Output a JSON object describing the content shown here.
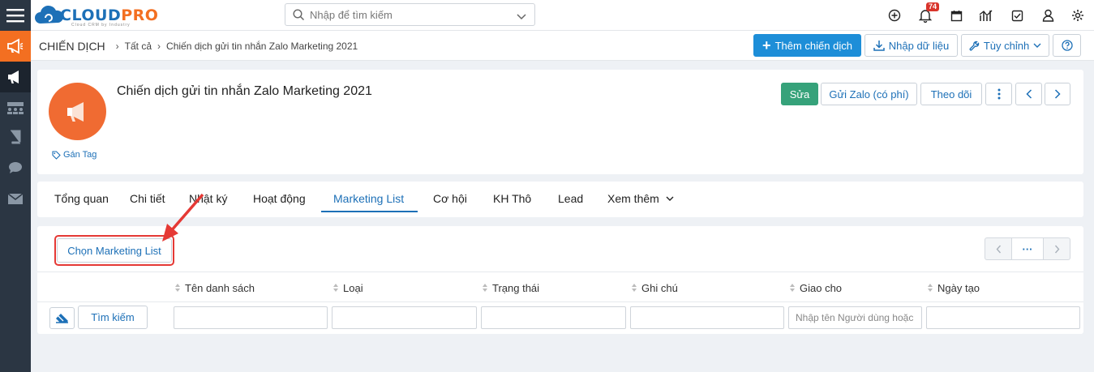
{
  "app": {
    "logo_cloud": "CLOUD",
    "logo_pro": "PRO",
    "logo_tagline": "Cloud CRM by Industry"
  },
  "search": {
    "placeholder": "Nhập để tìm kiếm"
  },
  "topbar": {
    "notification_count": "74",
    "icons": [
      "plus-circle-icon",
      "bell-icon",
      "calendar-icon",
      "chart-icon",
      "checkbox-icon",
      "user-icon",
      "gear-icon"
    ]
  },
  "breadcrumb": {
    "module": "CHIẾN DỊCH",
    "level1": "Tất cả",
    "level2": "Chiến dịch gửi tin nhắn Zalo Marketing 2021"
  },
  "toolbar": {
    "add_label": "Thêm chiến dịch",
    "import_label": "Nhập dữ liệu",
    "customize_label": "Tùy chỉnh"
  },
  "record": {
    "title": "Chiến dịch gửi tin nhắn Zalo Marketing 2021",
    "tag_label": "Gán Tag",
    "edit_label": "Sửa",
    "zalo_label": "Gửi Zalo (có phí)",
    "follow_label": "Theo dõi"
  },
  "tabs": [
    {
      "label": "Tổng quan"
    },
    {
      "label": "Chi tiết"
    },
    {
      "label": "Nhật ký"
    },
    {
      "label": "Hoạt động"
    },
    {
      "label": "Marketing List"
    },
    {
      "label": "Cơ hội"
    },
    {
      "label": "KH Thô"
    },
    {
      "label": "Lead"
    },
    {
      "label": "Xem thêm"
    }
  ],
  "active_tab": "Marketing List",
  "related": {
    "select_label": "Chọn Marketing List",
    "pager_more": "···",
    "columns": [
      "Tên danh sách",
      "Loại",
      "Trạng thái",
      "Ghi chú",
      "Giao cho",
      "Ngày tạo"
    ],
    "search_label": "Tìm kiếm",
    "assignee_placeholder": "Nhập tên Người dùng hoặc t"
  },
  "colors": {
    "accent": "#1d70b7",
    "brand_orange": "#f36f21",
    "primary_button": "#1d8ed8",
    "edit_button": "#36a27a",
    "sidebar": "#2b3643",
    "highlight": "#e53935"
  }
}
